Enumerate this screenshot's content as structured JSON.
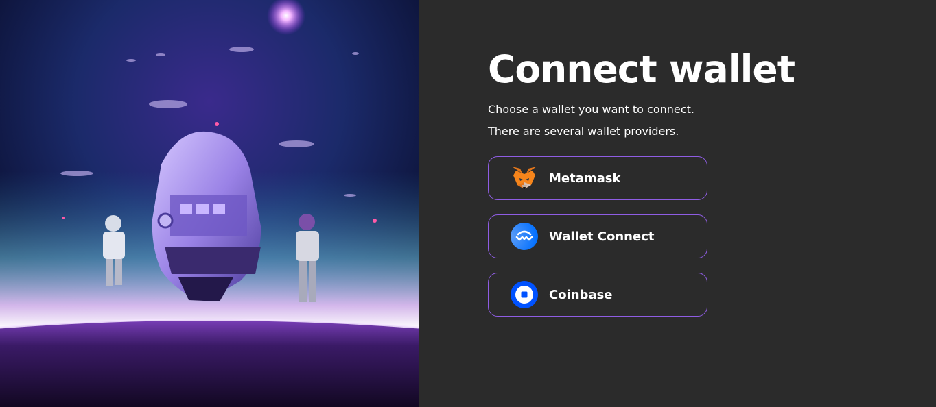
{
  "hero_image": {
    "description_icon": "astronauts-spaceship-icon"
  },
  "header": {
    "title": "Connect wallet",
    "subtitle": "Choose a wallet you want to connect. There are several wallet providers."
  },
  "wallets": [
    {
      "label": "Metamask",
      "icon": "metamask-fox-icon"
    },
    {
      "label": "Wallet Connect",
      "icon": "walletconnect-icon"
    },
    {
      "label": "Coinbase",
      "icon": "coinbase-icon"
    }
  ],
  "colors": {
    "panel_background": "#2b2b2b",
    "button_border": "#8f5de3",
    "text": "#ffffff",
    "walletconnect_blue": "#3b99fc",
    "coinbase_blue": "#0052ff",
    "metamask_orange": "#e2761b"
  }
}
